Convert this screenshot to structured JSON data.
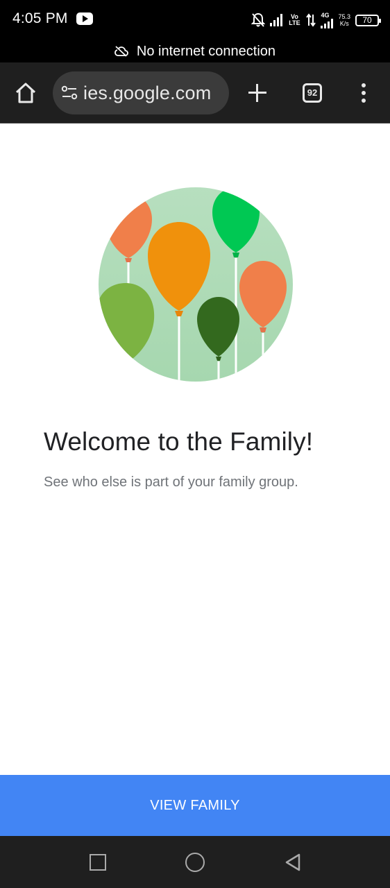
{
  "status_bar": {
    "time": "4:05 PM",
    "volte_label": "Vo LTE",
    "network_label": "4G",
    "speed_value": "75.3",
    "speed_unit": "K/s",
    "battery": "70"
  },
  "banner": {
    "text": "No internet connection"
  },
  "browser": {
    "url": "ies.google.com",
    "tab_count": "92"
  },
  "main": {
    "title": "Welcome to the Family!",
    "subtitle": "See who else is part of your family group."
  },
  "cta": {
    "label": "VIEW FAMILY",
    "color": "#4285f4"
  },
  "icons": [
    "youtube-icon",
    "mute-icon",
    "signal-icon",
    "battery-icon",
    "cloud-off-icon",
    "home-icon",
    "tune-icon",
    "plus-icon",
    "tabs-icon",
    "more-vert-icon",
    "recents-icon",
    "home-nav-icon",
    "back-icon"
  ]
}
